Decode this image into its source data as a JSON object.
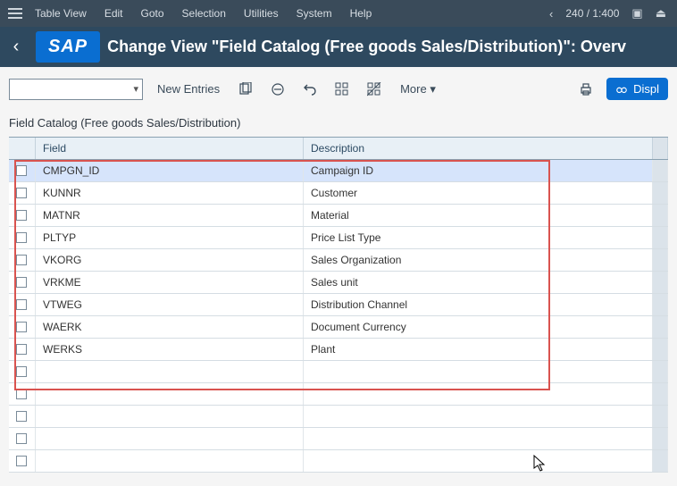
{
  "menu": {
    "items": [
      "Table View",
      "Edit",
      "Goto",
      "Selection",
      "Utilities",
      "System",
      "Help"
    ],
    "zoom": "240 / 1:400"
  },
  "header": {
    "logo": "SAP",
    "title": "Change View \"Field Catalog (Free goods Sales/Distribution)\": Overv"
  },
  "toolbar": {
    "new_entries": "New Entries",
    "more": "More"
  },
  "display_btn": "Displ",
  "section_title": "Field Catalog (Free goods Sales/Distribution)",
  "columns": {
    "field": "Field",
    "description": "Description"
  },
  "rows": [
    {
      "field": "CMPGN_ID",
      "desc": "Campaign ID"
    },
    {
      "field": "KUNNR",
      "desc": "Customer"
    },
    {
      "field": "MATNR",
      "desc": "Material"
    },
    {
      "field": "PLTYP",
      "desc": "Price List Type"
    },
    {
      "field": "VKORG",
      "desc": "Sales Organization"
    },
    {
      "field": "VRKME",
      "desc": "Sales unit"
    },
    {
      "field": "VTWEG",
      "desc": "Distribution Channel"
    },
    {
      "field": "WAERK",
      "desc": "Document Currency"
    },
    {
      "field": "WERKS",
      "desc": "Plant"
    }
  ],
  "blank_rows": 5
}
